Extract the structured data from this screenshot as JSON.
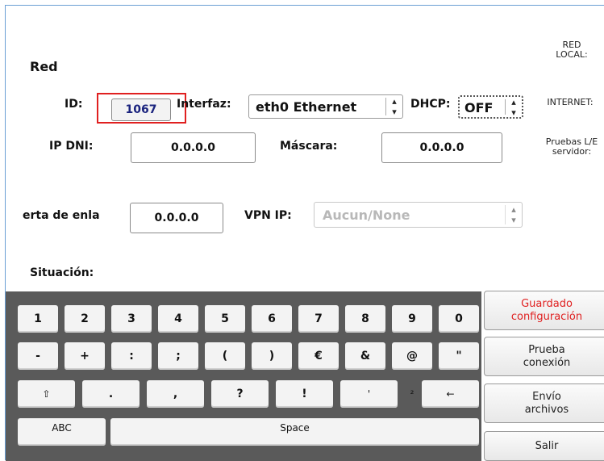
{
  "section_title": "Red",
  "side_labels": {
    "red_local": "RED\nLOCAL:",
    "internet": "INTERNET:",
    "pruebas": "Pruebas L/E\nservidor:"
  },
  "id": {
    "label": "ID:",
    "value": "1067"
  },
  "interfaz": {
    "label": "Interfaz:",
    "value": "eth0 Ethernet"
  },
  "dhcp": {
    "label": "DHCP:",
    "value": "OFF"
  },
  "ip_dni": {
    "label": "IP DNI:",
    "value": "0.0.0.0"
  },
  "mascara": {
    "label": "Máscara:",
    "value": "0.0.0.0"
  },
  "gateway": {
    "label": "erta de enla",
    "value": "0.0.0.0"
  },
  "vpn": {
    "label": "VPN IP:",
    "value": "Aucun/None"
  },
  "situacion": {
    "label": "Situación:"
  },
  "keyboard": {
    "row1": [
      "1",
      "2",
      "3",
      "4",
      "5",
      "6",
      "7",
      "8",
      "9",
      "0"
    ],
    "row2": [
      "-",
      "+",
      ":",
      ";",
      "(",
      ")",
      "€",
      "&",
      "@",
      "\""
    ],
    "row3": [
      "⇧",
      ".",
      ",",
      "?",
      "!",
      "'",
      "²",
      "←"
    ],
    "abc": "ABC",
    "space": "Space"
  },
  "actions": {
    "guardar": "Guardado\nconfiguración",
    "prueba": "Prueba\nconexión",
    "envio": "Envío\narchivos",
    "salir": "Salir"
  },
  "colors": {
    "accent_red": "#e02020",
    "id_text": "#1a237e",
    "frame_border": "#6a9fd4",
    "keyboard_bg": "#5a5a5a"
  }
}
